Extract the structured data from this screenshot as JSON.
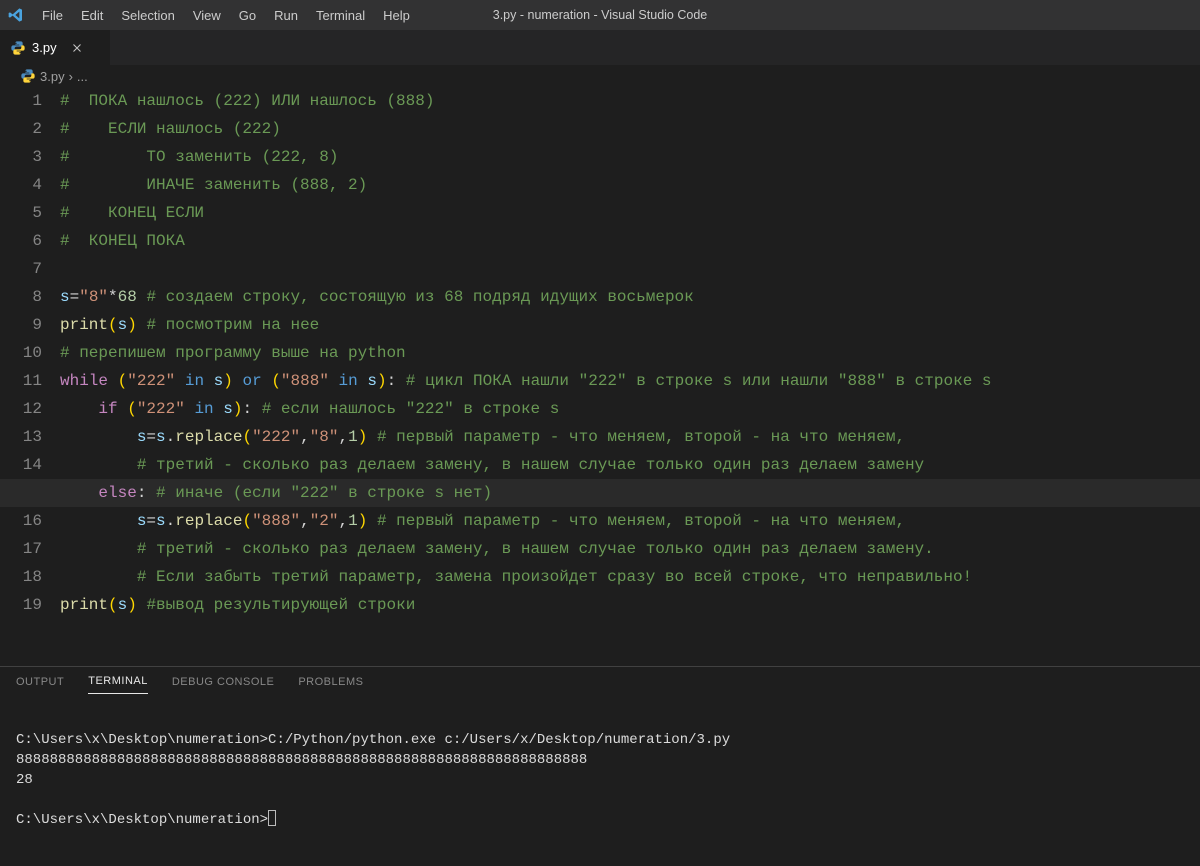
{
  "title": "3.py - numeration - Visual Studio Code",
  "menu": [
    "File",
    "Edit",
    "Selection",
    "View",
    "Go",
    "Run",
    "Terminal",
    "Help"
  ],
  "tab": {
    "label": "3.py"
  },
  "breadcrumb": {
    "file": "3.py",
    "sep": "›",
    "more": "..."
  },
  "highlight_line": 15,
  "code": [
    [
      {
        "c": "tok-comment",
        "t": "#  ПОКА нашлось (222) ИЛИ нашлось (888)"
      }
    ],
    [
      {
        "c": "tok-comment",
        "t": "#    ЕСЛИ нашлось (222)"
      }
    ],
    [
      {
        "c": "tok-comment",
        "t": "#        ТО заменить (222, 8)"
      }
    ],
    [
      {
        "c": "tok-comment",
        "t": "#        ИНАЧЕ заменить (888, 2)"
      }
    ],
    [
      {
        "c": "tok-comment",
        "t": "#    КОНЕЦ ЕСЛИ"
      }
    ],
    [
      {
        "c": "tok-comment",
        "t": "#  КОНЕЦ ПОКА"
      }
    ],
    [],
    [
      {
        "c": "tok-var",
        "t": "s"
      },
      {
        "c": "tok-op",
        "t": "="
      },
      {
        "c": "tok-str",
        "t": "\"8\""
      },
      {
        "c": "tok-op",
        "t": "*"
      },
      {
        "c": "tok-num",
        "t": "68"
      },
      {
        "c": "",
        "t": " "
      },
      {
        "c": "tok-comment",
        "t": "# создаем строку, состоящую из 68 подряд идущих восьмерок"
      }
    ],
    [
      {
        "c": "tok-func",
        "t": "print"
      },
      {
        "c": "tok-paren-y",
        "t": "("
      },
      {
        "c": "tok-var",
        "t": "s"
      },
      {
        "c": "tok-paren-y",
        "t": ")"
      },
      {
        "c": "",
        "t": " "
      },
      {
        "c": "tok-comment",
        "t": "# посмотрим на нее"
      }
    ],
    [
      {
        "c": "tok-comment",
        "t": "# перепишем программу выше на python"
      }
    ],
    [
      {
        "c": "tok-kw",
        "t": "while"
      },
      {
        "c": "",
        "t": " "
      },
      {
        "c": "tok-paren-y",
        "t": "("
      },
      {
        "c": "tok-str",
        "t": "\"222\""
      },
      {
        "c": "",
        "t": " "
      },
      {
        "c": "tok-kwblue",
        "t": "in"
      },
      {
        "c": "",
        "t": " "
      },
      {
        "c": "tok-var",
        "t": "s"
      },
      {
        "c": "tok-paren-y",
        "t": ")"
      },
      {
        "c": "",
        "t": " "
      },
      {
        "c": "tok-kwblue",
        "t": "or"
      },
      {
        "c": "",
        "t": " "
      },
      {
        "c": "tok-paren-y",
        "t": "("
      },
      {
        "c": "tok-str",
        "t": "\"888\""
      },
      {
        "c": "",
        "t": " "
      },
      {
        "c": "tok-kwblue",
        "t": "in"
      },
      {
        "c": "",
        "t": " "
      },
      {
        "c": "tok-var",
        "t": "s"
      },
      {
        "c": "tok-paren-y",
        "t": ")"
      },
      {
        "c": "tok-op",
        "t": ":"
      },
      {
        "c": "",
        "t": " "
      },
      {
        "c": "tok-comment",
        "t": "# цикл ПОКА нашли \"222\" в строке s или нашли \"888\" в строке s"
      }
    ],
    [
      {
        "c": "",
        "t": "    "
      },
      {
        "c": "tok-kw",
        "t": "if"
      },
      {
        "c": "",
        "t": " "
      },
      {
        "c": "tok-paren-y",
        "t": "("
      },
      {
        "c": "tok-str",
        "t": "\"222\""
      },
      {
        "c": "",
        "t": " "
      },
      {
        "c": "tok-kwblue",
        "t": "in"
      },
      {
        "c": "",
        "t": " "
      },
      {
        "c": "tok-var",
        "t": "s"
      },
      {
        "c": "tok-paren-y",
        "t": ")"
      },
      {
        "c": "tok-op",
        "t": ":"
      },
      {
        "c": "",
        "t": " "
      },
      {
        "c": "tok-comment",
        "t": "# если нашлось \"222\" в строке s"
      }
    ],
    [
      {
        "c": "",
        "t": "        "
      },
      {
        "c": "tok-var",
        "t": "s"
      },
      {
        "c": "tok-op",
        "t": "="
      },
      {
        "c": "tok-var",
        "t": "s"
      },
      {
        "c": "tok-op",
        "t": "."
      },
      {
        "c": "tok-func",
        "t": "replace"
      },
      {
        "c": "tok-paren-y",
        "t": "("
      },
      {
        "c": "tok-str",
        "t": "\"222\""
      },
      {
        "c": "tok-op",
        "t": ","
      },
      {
        "c": "tok-str",
        "t": "\"8\""
      },
      {
        "c": "tok-op",
        "t": ","
      },
      {
        "c": "tok-num",
        "t": "1"
      },
      {
        "c": "tok-paren-y",
        "t": ")"
      },
      {
        "c": "",
        "t": " "
      },
      {
        "c": "tok-comment",
        "t": "# первый параметр - что меняем, второй - на что меняем,"
      }
    ],
    [
      {
        "c": "",
        "t": "        "
      },
      {
        "c": "tok-comment",
        "t": "# третий - сколько раз делаем замену, в нашем случае только один раз делаем замену"
      }
    ],
    [
      {
        "c": "",
        "t": "    "
      },
      {
        "c": "tok-kw",
        "t": "else"
      },
      {
        "c": "tok-op",
        "t": ":"
      },
      {
        "c": "",
        "t": " "
      },
      {
        "c": "tok-comment",
        "t": "# иначе (если \"222\" в строке s нет)"
      }
    ],
    [
      {
        "c": "",
        "t": "        "
      },
      {
        "c": "tok-var",
        "t": "s"
      },
      {
        "c": "tok-op",
        "t": "="
      },
      {
        "c": "tok-var",
        "t": "s"
      },
      {
        "c": "tok-op",
        "t": "."
      },
      {
        "c": "tok-func",
        "t": "replace"
      },
      {
        "c": "tok-paren-y",
        "t": "("
      },
      {
        "c": "tok-str",
        "t": "\"888\""
      },
      {
        "c": "tok-op",
        "t": ","
      },
      {
        "c": "tok-str",
        "t": "\"2\""
      },
      {
        "c": "tok-op",
        "t": ","
      },
      {
        "c": "tok-num",
        "t": "1"
      },
      {
        "c": "tok-paren-y",
        "t": ")"
      },
      {
        "c": "",
        "t": " "
      },
      {
        "c": "tok-comment",
        "t": "# первый параметр - что меняем, второй - на что меняем,"
      }
    ],
    [
      {
        "c": "",
        "t": "        "
      },
      {
        "c": "tok-comment",
        "t": "# третий - сколько раз делаем замену, в нашем случае только один раз делаем замену."
      }
    ],
    [
      {
        "c": "",
        "t": "        "
      },
      {
        "c": "tok-comment",
        "t": "# Если забыть третий параметр, замена произойдет сразу во всей строке, что неправильно!"
      }
    ],
    [
      {
        "c": "tok-func",
        "t": "print"
      },
      {
        "c": "tok-paren-y",
        "t": "("
      },
      {
        "c": "tok-var",
        "t": "s"
      },
      {
        "c": "tok-paren-y",
        "t": ")"
      },
      {
        "c": "",
        "t": " "
      },
      {
        "c": "tok-comment",
        "t": "#вывод результирующей строки"
      }
    ]
  ],
  "panel": {
    "tabs": [
      "OUTPUT",
      "TERMINAL",
      "DEBUG CONSOLE",
      "PROBLEMS"
    ],
    "active": "TERMINAL"
  },
  "terminal": {
    "line1": "C:\\Users\\x\\Desktop\\numeration>C:/Python/python.exe c:/Users/x/Desktop/numeration/3.py",
    "line2": "88888888888888888888888888888888888888888888888888888888888888888888",
    "line3": "28",
    "line4": "",
    "prompt": "C:\\Users\\x\\Desktop\\numeration>"
  }
}
